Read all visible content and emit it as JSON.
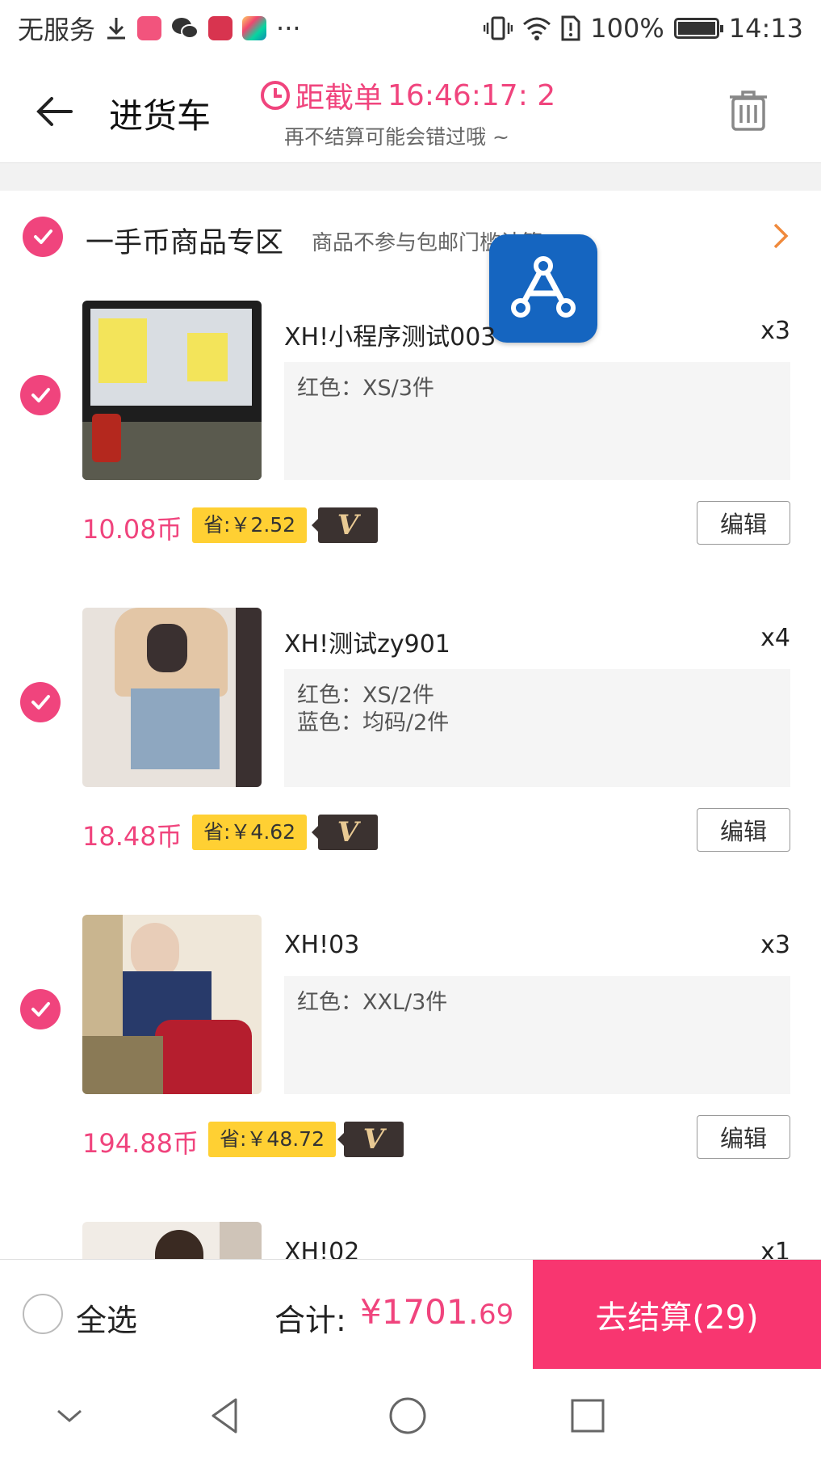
{
  "status_bar": {
    "carrier": "无服务",
    "more": "···",
    "battery": "100%",
    "time": "14:13"
  },
  "header": {
    "title": "进货车",
    "deadline_label": "距截单",
    "countdown": "16:46:17: 2",
    "subtitle": "再不结算可能会错过哦 ~"
  },
  "section": {
    "title": "一手币商品专区",
    "note": "商品不参与包邮门槛计算"
  },
  "products": [
    {
      "name": "XH!小程序测试003",
      "qty": "x3",
      "specs": [
        "红色：XS/3件"
      ],
      "price": "10.08币",
      "save": "省:￥2.52",
      "edit": "编辑"
    },
    {
      "name": "XH!测试zy901",
      "qty": "x4",
      "specs": [
        "红色：XS/2件",
        "蓝色：均码/2件"
      ],
      "price": "18.48币",
      "save": "省:￥4.62",
      "edit": "编辑"
    },
    {
      "name": "XH!03",
      "qty": "x3",
      "specs": [
        "红色：XXL/3件"
      ],
      "price": "194.88币",
      "save": "省:￥48.72",
      "edit": "编辑"
    },
    {
      "name": "XH!02",
      "qty": "x1"
    }
  ],
  "vip_tag": "V",
  "bottom": {
    "select_all": "全选",
    "total_label": "合计:",
    "total_main": "¥1701.",
    "total_cents": "69",
    "checkout": "去结算(29)"
  },
  "colors": {
    "accent": "#f0447d",
    "checkout": "#f83670",
    "save_tag": "#ffd033",
    "vip_tag": "#3b3230"
  },
  "icons": [
    "back-arrow-icon",
    "clock-icon",
    "trash-icon",
    "chevron-right-icon",
    "checkmark-icon",
    "vip-icon",
    "nav-down-icon",
    "nav-back-icon",
    "nav-home-icon",
    "nav-recents-icon"
  ]
}
